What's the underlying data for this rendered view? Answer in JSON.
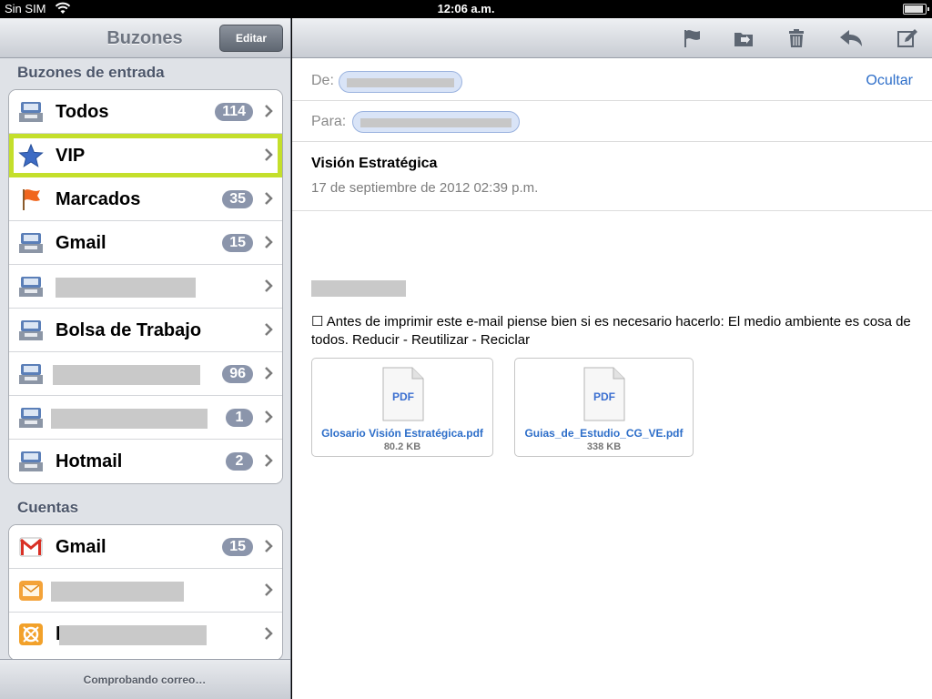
{
  "status_bar": {
    "carrier": "Sin SIM",
    "time": "12:06 a.m."
  },
  "sidebar": {
    "title": "Buzones",
    "edit_label": "Editar",
    "inboxes_header": "Buzones de entrada",
    "inboxes": [
      {
        "label": "Todos",
        "badge": "114",
        "icon": "inbox-tray-icon"
      },
      {
        "label": "VIP",
        "badge": "",
        "icon": "star-icon"
      },
      {
        "label": "Marcados",
        "badge": "35",
        "icon": "flag-icon"
      },
      {
        "label": "Gmail",
        "badge": "15",
        "icon": "inbox-tray-icon"
      },
      {
        "label": "",
        "badge": "",
        "icon": "inbox-tray-icon"
      },
      {
        "label": "Bolsa de Trabajo",
        "badge": "",
        "icon": "inbox-tray-icon"
      },
      {
        "label": "",
        "badge": "96",
        "icon": "inbox-tray-icon"
      },
      {
        "label": "",
        "badge": "1",
        "icon": "inbox-tray-icon"
      },
      {
        "label": "Hotmail",
        "badge": "2",
        "icon": "inbox-tray-icon"
      }
    ],
    "accounts_header": "Cuentas",
    "accounts": [
      {
        "label": "Gmail",
        "badge": "15",
        "icon": "gmail-icon"
      },
      {
        "label": "",
        "badge": "",
        "icon": "envelope-icon"
      },
      {
        "label": "l",
        "badge": "",
        "icon": "orange-account-icon"
      }
    ],
    "footer_status": "Comprobando correo…"
  },
  "message": {
    "from_label": "De:",
    "to_label": "Para:",
    "hide_label": "Ocultar",
    "subject": "Visión Estratégica",
    "date": "17 de septiembre de 2012 02:39 p.m.",
    "body": "☐ Antes de imprimir este e-mail piense bien si es necesario hacerlo: El medio ambiente es cosa de todos. Reducir - Reutilizar - Reciclar",
    "attachments": [
      {
        "type_label": "PDF",
        "filename": "Glosario Visión Estratégica.pdf",
        "size": "80.2 KB"
      },
      {
        "type_label": "PDF",
        "filename": "Guias_de_Estudio_CG_VE.pdf",
        "size": "338 KB"
      }
    ]
  },
  "toolbar_icons": [
    "flag-icon",
    "move-folder-icon",
    "trash-icon",
    "reply-icon",
    "compose-icon"
  ],
  "colors": {
    "highlight": "#c4df2b",
    "badge": "#8b95ab",
    "link": "#2d6ec9"
  }
}
